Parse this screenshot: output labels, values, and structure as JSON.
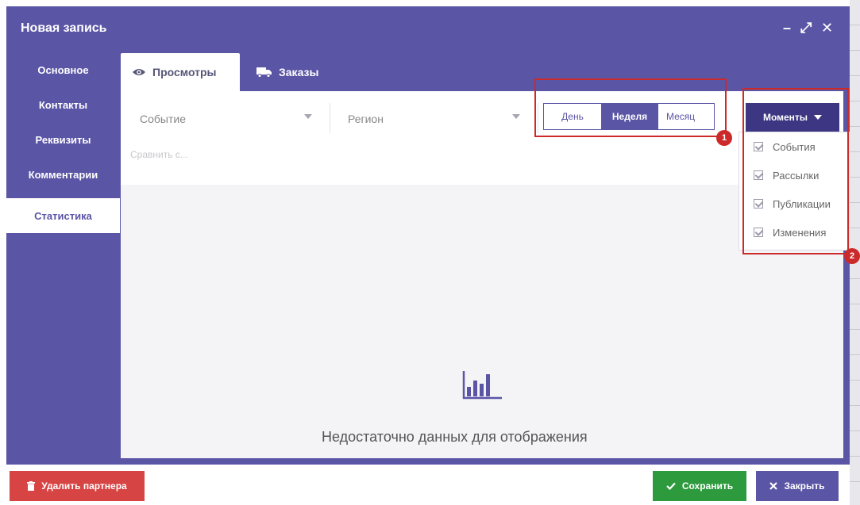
{
  "window": {
    "title": "Новая запись",
    "controls": {
      "minimize": "–",
      "maximize": "⤢",
      "close": "✕"
    }
  },
  "sidebar": {
    "items": [
      {
        "label": "Основное"
      },
      {
        "label": "Контакты"
      },
      {
        "label": "Реквизиты"
      },
      {
        "label": "Комментарии"
      },
      {
        "label": "Статистика",
        "active": true
      }
    ]
  },
  "tabs": [
    {
      "label": "Просмотры",
      "icon": "eye-icon",
      "active": true
    },
    {
      "label": "Заказы",
      "icon": "truck-icon",
      "active": false
    }
  ],
  "filters": {
    "event_placeholder": "Событие",
    "region_placeholder": "Регион",
    "compare_placeholder": "Сравнить с..."
  },
  "period": {
    "options": [
      "День",
      "Неделя",
      "Месяц"
    ],
    "selected": "Неделя"
  },
  "moments": {
    "button_label": "Моменты",
    "items": [
      {
        "label": "События",
        "checked": true
      },
      {
        "label": "Рассылки",
        "checked": true
      },
      {
        "label": "Публикации",
        "checked": true
      },
      {
        "label": "Изменения",
        "checked": true
      }
    ]
  },
  "annotations": {
    "marker1": "1",
    "marker2": "2"
  },
  "empty_state": {
    "icon": "bar-chart-icon",
    "text": "Недостаточно данных для отображения"
  },
  "footer": {
    "delete_label": "Удалить партнера",
    "save_label": "Сохранить",
    "close_label": "Закрыть"
  },
  "colors": {
    "accent": "#5b55a6",
    "accent_dark": "#3d3783",
    "danger": "#d74444",
    "success": "#2e9a3e",
    "highlight": "#cc2a2a"
  }
}
